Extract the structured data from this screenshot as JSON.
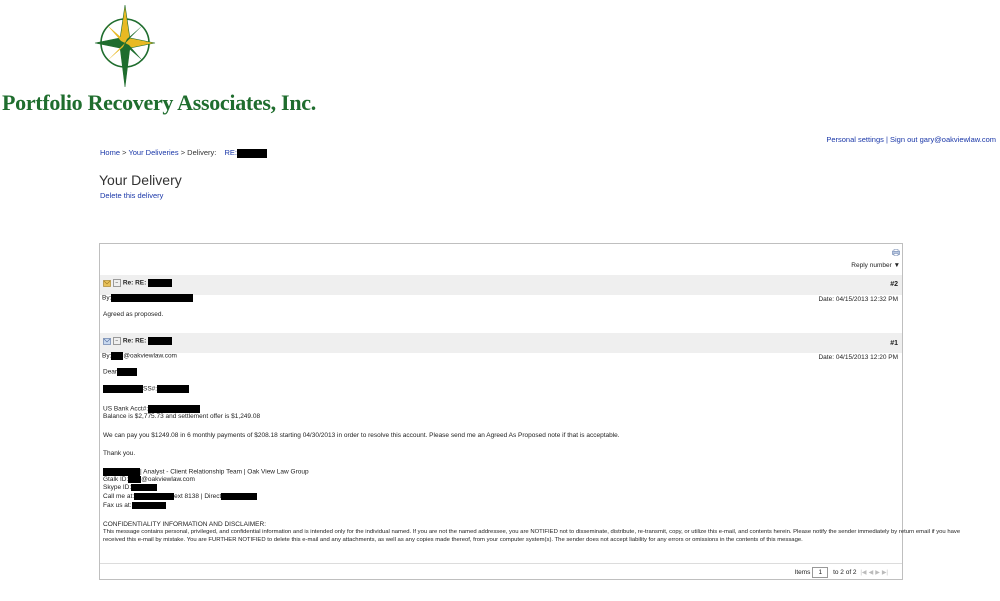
{
  "company": {
    "name": "Portfolio Recovery Associates, Inc."
  },
  "colors": {
    "brand_green": "#1f6d2e",
    "logo_gold": "#e8b923",
    "link_blue": "#1a37a8",
    "header_gray": "#efefef"
  },
  "user_links": {
    "settings": "Personal settings",
    "separator": " | ",
    "sign_out": "Sign out gary@oakviewlaw.com"
  },
  "breadcrumb": {
    "home": "Home",
    "sep": " > ",
    "deliveries": "Your Deliveries",
    "current": "Delivery:",
    "current_prefix": "RE:"
  },
  "page": {
    "title": "Your Delivery",
    "delete": "Delete this delivery"
  },
  "toolbar": {
    "print_icon": "print-icon",
    "reply": "Reply number ▼"
  },
  "messages": [
    {
      "subject": "Re: RE:",
      "number": "#2",
      "by": "By:",
      "date": "Date: 04/15/2013 12:32 PM",
      "body": "Agreed as proposed."
    },
    {
      "subject": "Re: RE:",
      "number": "#1",
      "by": "By:",
      "by_domain": "@oakviewlaw.com",
      "date": "Date: 04/15/2013 12:20 PM",
      "greeting": "Dear",
      "ss_label": "SS#:",
      "bank": "US Bank Acct#:",
      "balance": "Balance is $2,775.73 and settlement offer is $1,249.08",
      "offer": "We can pay you $1249.08 in 6 monthly payments of $208.18 starting 04/30/2013 in order to resolve this account. Please send me an Agreed As Proposed note if that is acceptable.",
      "thanks": "Thank you.",
      "sig_title": "| Analyst - Client Relationship Team | Oak View Law Group",
      "gtalk_label": "Gtalk ID:",
      "gtalk_domain": "@oakviewlaw.com",
      "skype_label": "Skype ID:",
      "call_label": "Call me at:",
      "call_ext": "ext 8138 | Direct",
      "fax_label": "Fax us at:",
      "disclaimer_title": "CONFIDENTIALITY INFORMATION AND DISCLAIMER:",
      "disclaimer_1": "This message contains personal, privileged, and confidential information and is intended only for the individual named. If you are not the named addressee, you are NOTIFIED not to disseminate, distribute, re-transmit, copy, or utilize this e-mail, and contents herein. Please notify the sender immediately by return email if you have",
      "disclaimer_2": "received this e-mail by mistake. You are FURTHER NOTIFIED to delete this e-mail and any attachments, as well as any copies made thereof, from your computer system(s). The sender does not accept liability for any errors or omissions in the contents of this message."
    }
  ],
  "pager": {
    "items_label": "Items",
    "items_value": "1",
    "range": "to 2 of 2"
  }
}
